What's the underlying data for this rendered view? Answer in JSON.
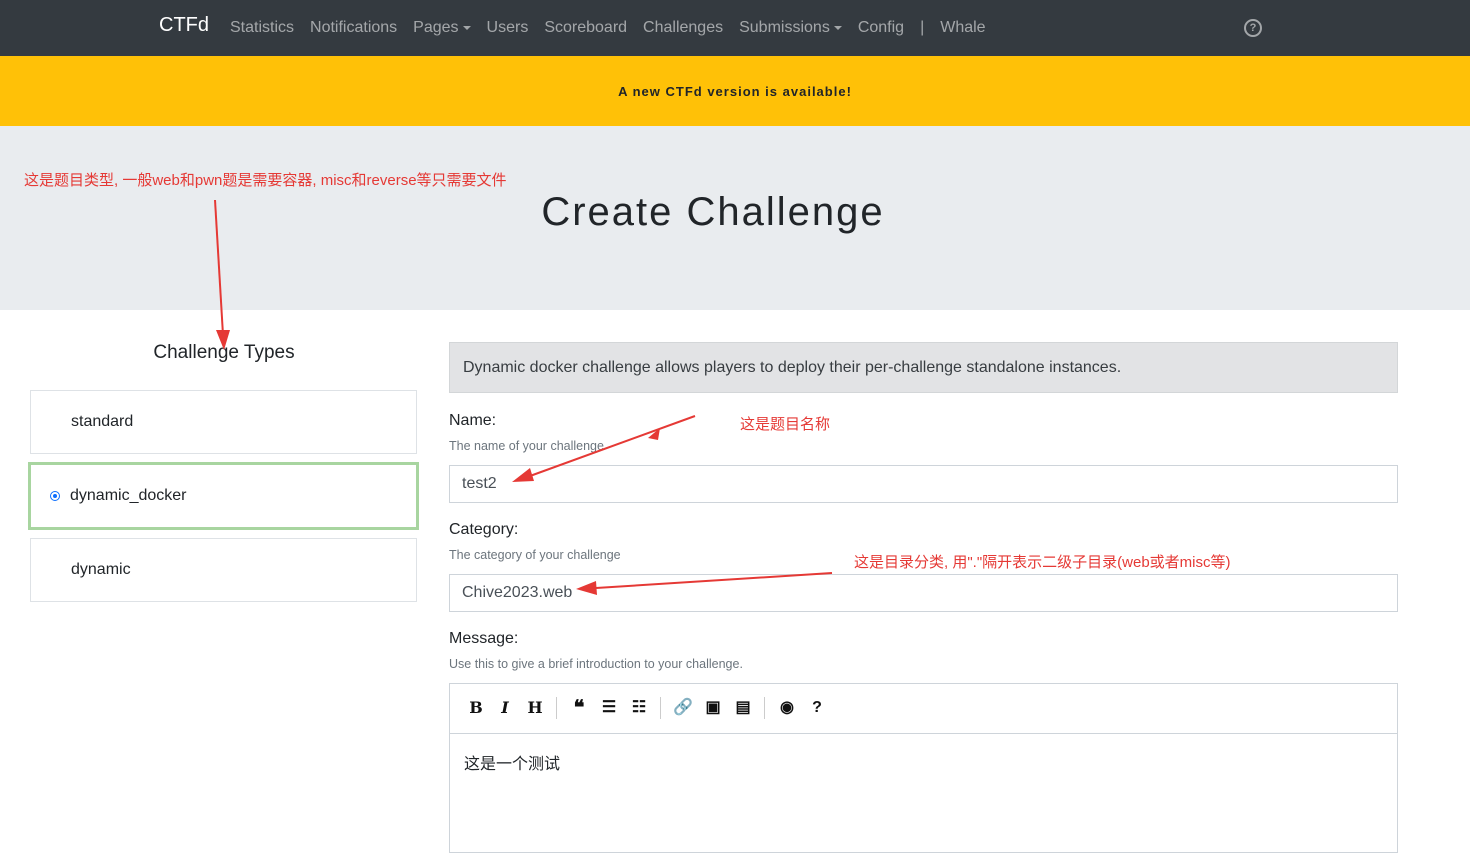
{
  "navbar": {
    "brand": "CTFd",
    "links": [
      "Statistics",
      "Notifications",
      "Pages",
      "Users",
      "Scoreboard",
      "Challenges",
      "Submissions",
      "Config"
    ],
    "separator": "|",
    "extra_link": "Whale",
    "help_icon": "question-circle-icon"
  },
  "banner": {
    "text": "A new CTFd version is available!"
  },
  "page": {
    "title": "Create Challenge"
  },
  "annotations": {
    "types_note": "这是题目类型, 一般web和pwn题是需要容器, misc和reverse等只需要文件",
    "name_note": "这是题目名称",
    "category_note": "这是目录分类, 用\".\"隔开表示二级子目录(web或者misc等)"
  },
  "challenge_types": {
    "title": "Challenge Types",
    "items": [
      {
        "label": "standard",
        "selected": false
      },
      {
        "label": "dynamic_docker",
        "selected": true
      },
      {
        "label": "dynamic",
        "selected": false
      }
    ]
  },
  "form": {
    "info": "Dynamic docker challenge allows players to deploy their per-challenge standalone instances.",
    "name": {
      "label": "Name:",
      "help": "The name of your challenge",
      "value": "test2"
    },
    "category": {
      "label": "Category:",
      "help": "The category of your challenge",
      "value": "Chive2023.web"
    },
    "message": {
      "label": "Message:",
      "help": "Use this to give a brief introduction to your challenge.",
      "content": "这是一个测试",
      "toolbar": [
        "bold-icon",
        "italic-icon",
        "heading-icon",
        "quote-icon",
        "unordered-list-icon",
        "ordered-list-icon",
        "link-icon",
        "image-icon",
        "upload-file-icon",
        "preview-icon",
        "guide-icon"
      ]
    }
  },
  "colors": {
    "navbar": "#343a40",
    "banner": "#ffc107",
    "annotation": "#e53935",
    "selected_border": "#a8d5a0"
  }
}
